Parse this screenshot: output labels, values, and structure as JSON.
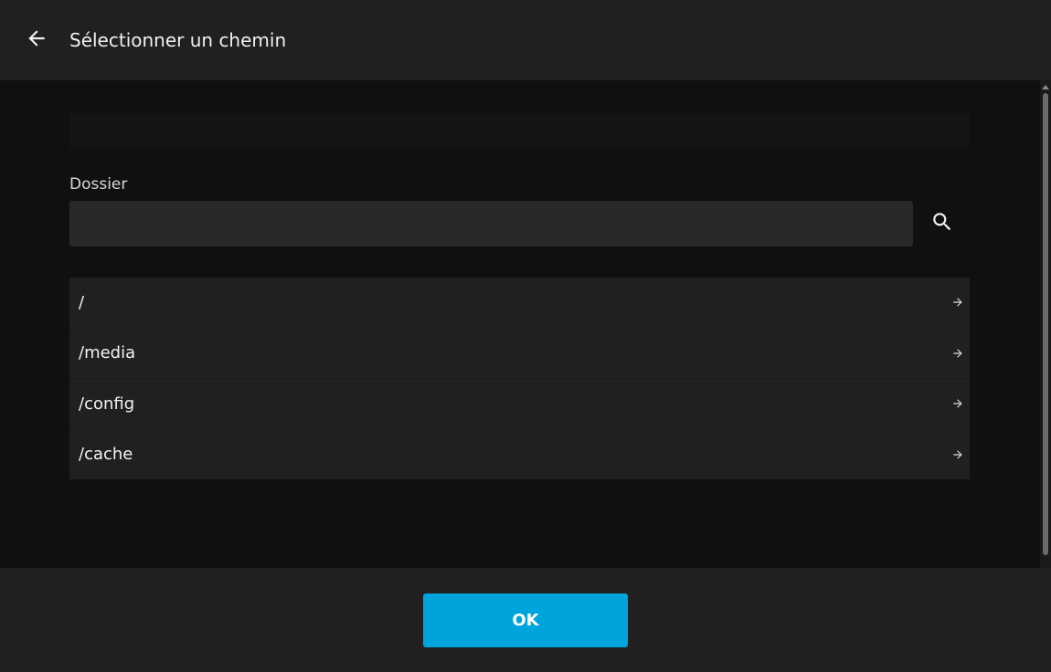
{
  "header": {
    "title": "Sélectionner un chemin",
    "back_icon": "arrow-left-icon"
  },
  "path_bar": {
    "value": ""
  },
  "folder": {
    "label": "Dossier",
    "value": "",
    "search_icon": "search-icon"
  },
  "directories": [
    {
      "label": "/",
      "icon": "arrow-right-icon"
    },
    {
      "label": "/media",
      "icon": "arrow-right-icon"
    },
    {
      "label": "/config",
      "icon": "arrow-right-icon"
    },
    {
      "label": "/cache",
      "icon": "arrow-right-icon"
    }
  ],
  "footer": {
    "ok_label": "OK"
  },
  "colors": {
    "accent": "#00a4dc",
    "header_bg": "#202020",
    "content_bg": "#101010"
  }
}
